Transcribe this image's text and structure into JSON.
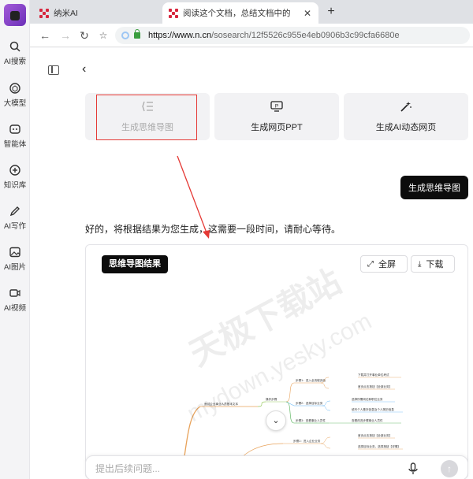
{
  "rail": {
    "items": [
      {
        "label": "AI搜索",
        "icon": "search-icon"
      },
      {
        "label": "大模型",
        "icon": "cube-icon"
      },
      {
        "label": "智能体",
        "icon": "agent-icon"
      },
      {
        "label": "知识库",
        "icon": "knowledge-icon"
      },
      {
        "label": "AI写作",
        "icon": "pen-icon"
      },
      {
        "label": "AI图片",
        "icon": "image-icon"
      },
      {
        "label": "AI视频",
        "icon": "video-icon"
      }
    ]
  },
  "browser": {
    "tabs": [
      {
        "title": "纳米AI"
      },
      {
        "title": "阅读这个文档，总结文档中的",
        "close": "✕"
      }
    ],
    "new_tab": "+",
    "url_host": "https://www.n.cn",
    "url_path": "/sosearch/12f5526c955e4eb0906b3c99cfa6680e"
  },
  "actions": {
    "mindmap": {
      "label": "生成思维导图",
      "icon": "mindmap-icon"
    },
    "ppt": {
      "label": "生成网页PPT",
      "icon": "ppt-icon"
    },
    "ai_page": {
      "label": "生成AI动态网页",
      "icon": "magic-wand-icon"
    }
  },
  "chat": {
    "user_message": "生成思维导图",
    "assistant_reply": "好的，将根据结果为您生成，这需要一段时间，请耐心等待。"
  },
  "result": {
    "badge": "思维导图结果",
    "fullscreen_label": "全屏",
    "download_label": "下载",
    "mindmap": {
      "root": "面试企业事业人员基本文本",
      "branches": [
        {
          "label": "操作步骤",
          "children": [
            {
              "label": "步骤1：进入全流程页面",
              "leaves": [
                "下载并打开事业单位考试",
                "首页点击按钮【全部业务】"
              ]
            },
            {
              "label": "步骤2：选择目标业务",
              "leaves": [
                "选择所需岗位和职位业务",
                "填写个人基本信息及个人简历信息"
              ]
            },
            {
              "label": "步骤3：查看事业人员件",
              "leaves": [
                "查看改进步骤事业人员件"
              ]
            }
          ]
        },
        {
          "label": "",
          "children": [
            {
              "label": "步骤1：进入企业业务",
              "leaves": [
                "首页点击按钮【全部业务】",
                "选择目标业务，选择按钮【详情】"
              ]
            }
          ]
        }
      ]
    }
  },
  "input": {
    "placeholder": "提出后续问题..."
  },
  "watermark": {
    "main": "天极下载站",
    "sub": "mydown.yesky.com"
  },
  "colors": {
    "accent_red": "#e53935",
    "badge_bg": "#0c0c0c",
    "branch_orange": "#e8a25a",
    "branch_green": "#4caf50",
    "branch_blue": "#64b5f6"
  }
}
